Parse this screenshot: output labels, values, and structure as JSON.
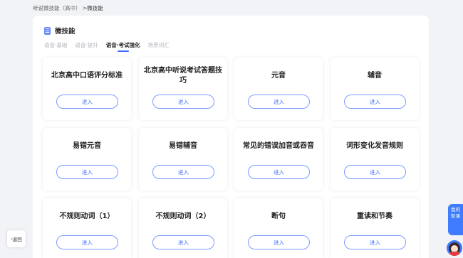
{
  "breadcrumb": {
    "parent": "听说微技能（高中）",
    "separator": " >",
    "current": "微技能"
  },
  "panel": {
    "title": "微技能",
    "tabs": [
      {
        "label": "语音·基础",
        "active": false
      },
      {
        "label": "语音·提升",
        "active": false
      },
      {
        "label": "语音·考试强化",
        "active": true
      },
      {
        "label": "场景词汇",
        "active": false
      }
    ]
  },
  "cards": [
    {
      "title": "北京高中口语评分标准",
      "button": "进入"
    },
    {
      "title": "北京高中听说考试答题技巧",
      "button": "进入"
    },
    {
      "title": "元音",
      "button": "进入"
    },
    {
      "title": "辅音",
      "button": "进入"
    },
    {
      "title": "易错元音",
      "button": "进入"
    },
    {
      "title": "易错辅音",
      "button": "进入"
    },
    {
      "title": "常见的错误加音或吞音",
      "button": "进入"
    },
    {
      "title": "词形变化发音规则",
      "button": "进入"
    },
    {
      "title": "不规则动词（1）",
      "button": "进入"
    },
    {
      "title": "不规则动词（2）",
      "button": "进入"
    },
    {
      "title": "断句",
      "button": "进入"
    },
    {
      "title": "重读和节奏",
      "button": "进入"
    }
  ],
  "back_button": {
    "arrow": "‹",
    "label": "返回"
  },
  "assistant": {
    "line1": "我的",
    "line2": "智课"
  },
  "colors": {
    "accent": "#3f6bff",
    "background": "#f2f3f7",
    "card": "#ffffff"
  }
}
